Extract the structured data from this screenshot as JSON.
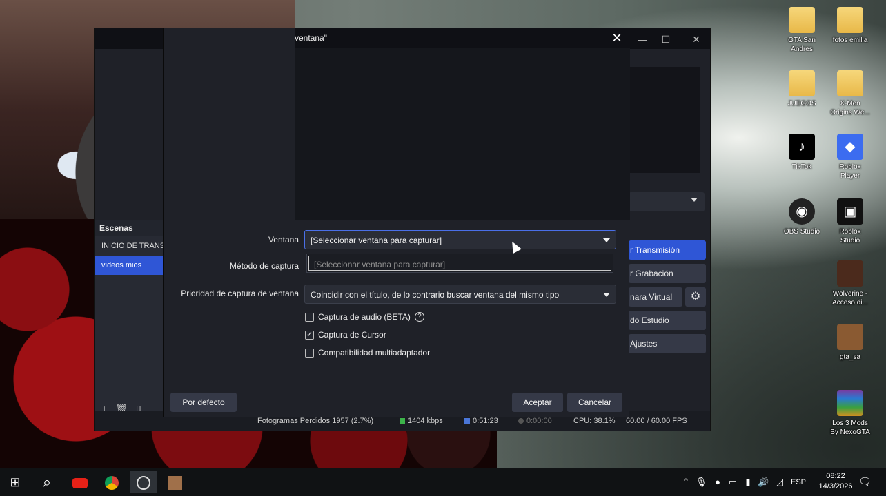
{
  "dialog": {
    "title": "ventana\"",
    "close_glyph": "✕",
    "ventana_label": "Ventana",
    "ventana_value": "[Seleccionar ventana para capturar]",
    "dropdown_option": "[Seleccionar ventana para capturar]",
    "metodo_label": "Método de captura",
    "prioridad_label": "Prioridad de captura de ventana",
    "prioridad_value": "Coincidir con el título, de lo contrario buscar ventana del mismo tipo",
    "checks": [
      {
        "label": "Captura de audio (BETA)",
        "checked": false,
        "help": "?"
      },
      {
        "label": "Captura de Cursor",
        "checked": true
      },
      {
        "label": "Compatibilidad multiadaptador",
        "checked": false
      }
    ],
    "defaults_button": "Por defecto",
    "accept_button": "Aceptar",
    "cancel_button": "Cancelar"
  },
  "obs": {
    "scenes_header": "Escenas",
    "scenes": [
      {
        "label": "INICIO DE TRANSMISION",
        "active": false
      },
      {
        "label": "videos mios",
        "active": true
      }
    ],
    "scene_tools": [
      "+",
      "🗑",
      "▯"
    ],
    "controls": [
      {
        "label": "r Transmisión",
        "primary": true
      },
      {
        "label": "r Grabación",
        "primary": false
      },
      {
        "label": "nara Virtual",
        "primary": false
      },
      {
        "label": "do Estudio",
        "primary": false
      },
      {
        "label": "Ajustes",
        "primary": false
      }
    ],
    "status": {
      "dropped": "Fotogramas Perdidos 1957 (2.7%)",
      "bitrate": "1404 kbps",
      "stream_time": "0:51:23",
      "rec_time": "0:00:00",
      "cpu": "CPU: 38.1%",
      "fps": "60.00 / 60.00 FPS"
    },
    "colors": {
      "accent": "#2f56d6",
      "panel": "#272a33"
    }
  },
  "desktop_icons": [
    {
      "label": "GTA San Andres",
      "icon": "folder-icon"
    },
    {
      "label": "fotos emilia",
      "icon": "folder-icon"
    },
    {
      "label": "JUEGOS",
      "icon": "folder-icon"
    },
    {
      "label": "X-Men Origins We...",
      "icon": "folder-icon"
    },
    {
      "label": "TikTok",
      "icon": "tiktok-icon"
    },
    {
      "label": "Roblox Player",
      "icon": "roblox-icon"
    },
    {
      "label": "OBS Studio",
      "icon": "obs-icon"
    },
    {
      "label": "Roblox Studio",
      "icon": "roblox-studio-icon"
    },
    {
      "label": "Wolverine - Acceso di...",
      "icon": "shortcut-icon"
    },
    {
      "label": "gta_sa",
      "icon": "shortcut-icon"
    },
    {
      "label": "Los 3 Mods By NexoGTA",
      "icon": "winrar-icon"
    }
  ],
  "taskbar": {
    "start": "⊞",
    "search": "⌕",
    "lang": "ESP",
    "time": "08:22",
    "date": "14/3/2026"
  }
}
